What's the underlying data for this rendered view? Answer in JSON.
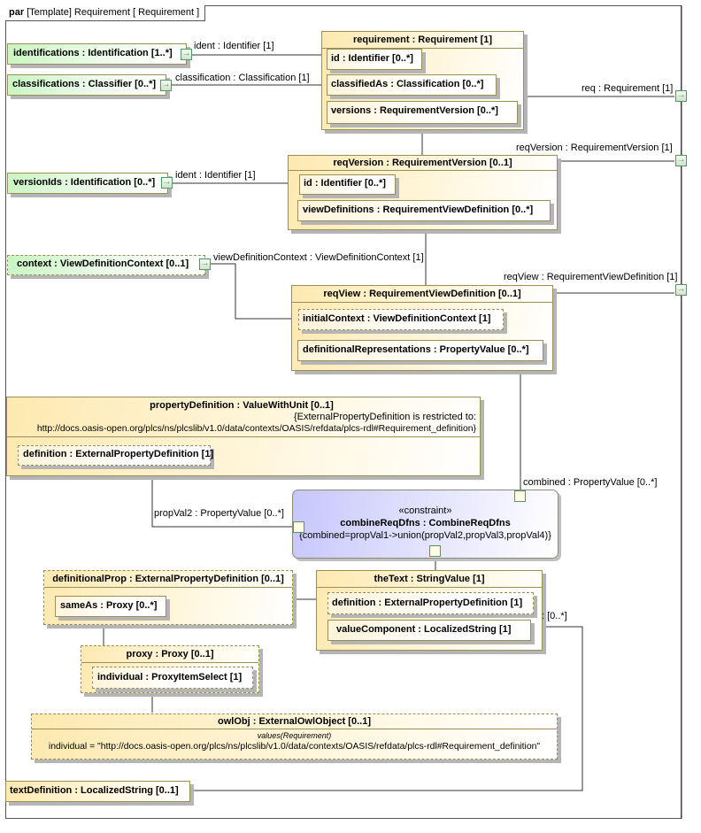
{
  "frame": {
    "keyword": "par",
    "title": "[Template] Requirement [ Requirement ]"
  },
  "parts": {
    "identifications": "identifications : Identification [1..*]",
    "classifications": "classifications : Classifier [0..*]",
    "versionIds": "versionIds : Identification [0..*]",
    "context": "context : ViewDefinitionContext [0..1]",
    "requirement": {
      "title": "requirement : Requirement [1]",
      "id": "id : Identifier [0..*]",
      "classifiedAs": "classifiedAs : Classification [0..*]",
      "versions": "versions : RequirementVersion [0..*]"
    },
    "reqVersion": {
      "title": "reqVersion : RequirementVersion [0..1]",
      "id": "id : Identifier [0..*]",
      "viewDefinitions": "viewDefinitions : RequirementViewDefinition [0..*]"
    },
    "reqView": {
      "title": "reqView : RequirementViewDefinition [0..1]",
      "initialContext": "initialContext : ViewDefinitionContext [1]",
      "definitionalRepresentations": "definitionalRepresentations : PropertyValue [0..*]"
    },
    "propertyDefinition": {
      "title": "propertyDefinition : ValueWithUnit [0..1]",
      "constraint_line1": "{ExternalPropertyDefinition is restricted to:",
      "constraint_line2": "http://docs.oasis-open.org/plcs/ns/plcslib/v1.0/data/contexts/OASIS/refdata/plcs-rdl#Requirement_definition}",
      "definition": "definition : ExternalPropertyDefinition [1]"
    },
    "combine": {
      "stereotype": "«constraint»",
      "title": "combineReqDfns : CombineReqDfns",
      "expression": "{combined=propVal1->union(propVal2,propVal3,propVal4)}"
    },
    "definitionalProp": {
      "title": "definitionalProp : ExternalPropertyDefinition [0..1]",
      "sameAs": "sameAs : Proxy [0..*]"
    },
    "theText": {
      "title": "theText : StringValue [1]",
      "definition": "definition : ExternalPropertyDefinition [1]",
      "valueComponent": "valueComponent : LocalizedString [1]"
    },
    "proxy": {
      "title": "proxy : Proxy [0..1]",
      "individual": "individual : ProxyItemSelect [1]"
    },
    "owlObj": {
      "title": "owlObj : ExternalOwlObject [0..1]",
      "values_header": "values(Requirement)",
      "individual": "individual = \"http://docs.oasis-open.org/plcs/ns/plcslib/v1.0/data/contexts/OASIS/refdata/plcs-rdl#Requirement_definition\""
    },
    "textDefinition": "textDefinition : LocalizedString [0..1]"
  },
  "connectors": {
    "ident1": "ident : Identifier [1]",
    "classification": "classification : Classification [1]",
    "req": "req : Requirement [1]",
    "reqVersion": "reqVersion : RequirementVersion [1]",
    "ident2": "ident : Identifier [1]",
    "viewDefinitionContext": "viewDefinitionContext : ViewDefinitionContext [1]",
    "reqView": "reqView : RequirementViewDefinition [1]",
    "combined": "combined : PropertyValue [0..*]",
    "propVal2": "propVal2 : PropertyValue [0..*]",
    "multiplicity": ": [0..*]"
  },
  "icons": {
    "port_arrow": "→"
  }
}
